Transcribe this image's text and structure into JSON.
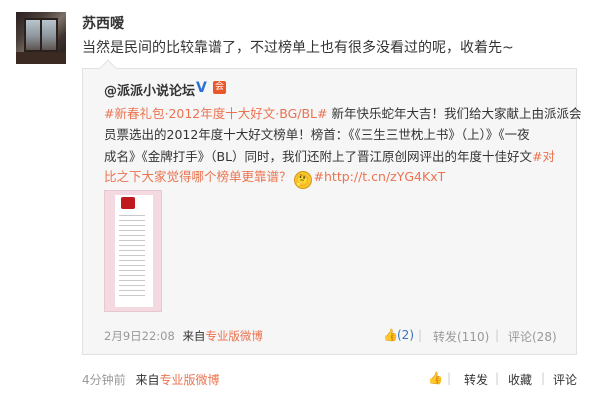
{
  "post": {
    "username": "苏西嗳",
    "text": "当然是民间的比较靠谱了，不过榜单上也有很多没看过的呢，收着先~",
    "time": "4分钟前",
    "source_prefix": "来自",
    "source": "专业版微博",
    "actions": {
      "repost": "转发",
      "favorite": "收藏",
      "comment": "评论"
    }
  },
  "quote": {
    "author": "@派派小说论坛",
    "v_badge": "V",
    "vip_badge": "会",
    "line1_topic": "#新春礼包·2012年度十大好文·BG/BL#",
    "line1_rest": " 新年快乐蛇年大吉！我们给大家献上由派派会",
    "line2": "员票选出的2012年度十大好文榜单！榜首：《《三生三世枕上书》（上）》《一夜",
    "line3_a": "成名》《金牌打手》（BL）同时，我们还附上了晋江原创网评出的年度十佳好文",
    "line3_topic": "#对",
    "line4_topic": "比之下大家觉得哪个榜单更靠谱？",
    "line4_emoji": "🤔",
    "line4_link": "#http://t.cn/zYG4KxT",
    "time": "2月9日22:08",
    "source_prefix": "来自",
    "source": "专业版微博",
    "actions": {
      "like": "(2)",
      "repost": "转发(110)",
      "comment": "评论(28)"
    }
  }
}
